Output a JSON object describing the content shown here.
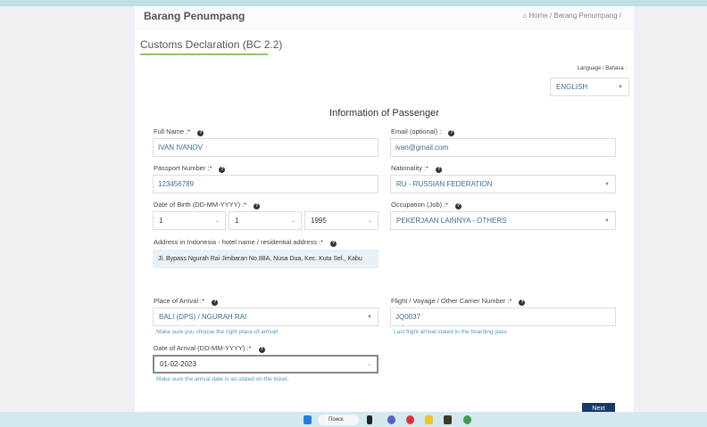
{
  "header": {
    "title": "Barang Penumpang",
    "breadcrumb": "⌂ Home  /  Barang Penumpang  /"
  },
  "card": {
    "title": "Customs Declaration (BC 2.2)"
  },
  "language": {
    "label": "Language / Bahasa :",
    "value": "ENGLISH"
  },
  "section_title": "Information of Passenger",
  "fields": {
    "full_name": {
      "label": "Full Name :*",
      "value": "IVAN IVANOV"
    },
    "email": {
      "label": "Email (optional) :",
      "value": "ivan@gmail.com"
    },
    "passport": {
      "label": "Passport Number :*",
      "value": "123456789"
    },
    "nationality": {
      "label": "Nationality :*",
      "value": "RU - RUSSIAN FEDERATION"
    },
    "dob": {
      "label": "Date of Birth (DD-MM-YYYY) :*",
      "day": "1",
      "month": "1",
      "year": "1995"
    },
    "occupation": {
      "label": "Occupation (Job) :*",
      "value": "PEKERJAAN LAINNYA - OTHERS"
    },
    "address": {
      "label": "Address in Indonesia - hotel name / residential address :*",
      "value": "Jl. Bypass Ngurah Rai Jimbaran No.88A, Nusa Dua, Kec. Kuta Sel., Kabu"
    },
    "place_arrival": {
      "label": "Place of Arrival :*",
      "value": "BALI (DPS) / NGURAH RAI",
      "help": "Make sure you choose the right place of arrival!"
    },
    "flight": {
      "label": "Flight / Voyage / Other Carrier Number :*",
      "value": "JQ0037",
      "help": "Last flight arrival stated in the boarding pass"
    },
    "date_arrival": {
      "label": "Date of Arrival (DD-MM-YYYY) :*",
      "value": "01-02-2023",
      "help": "Make sure the arrival date is as stated on the ticket."
    }
  },
  "next_label": "Next",
  "taskbar": {
    "search": "Поиск"
  }
}
